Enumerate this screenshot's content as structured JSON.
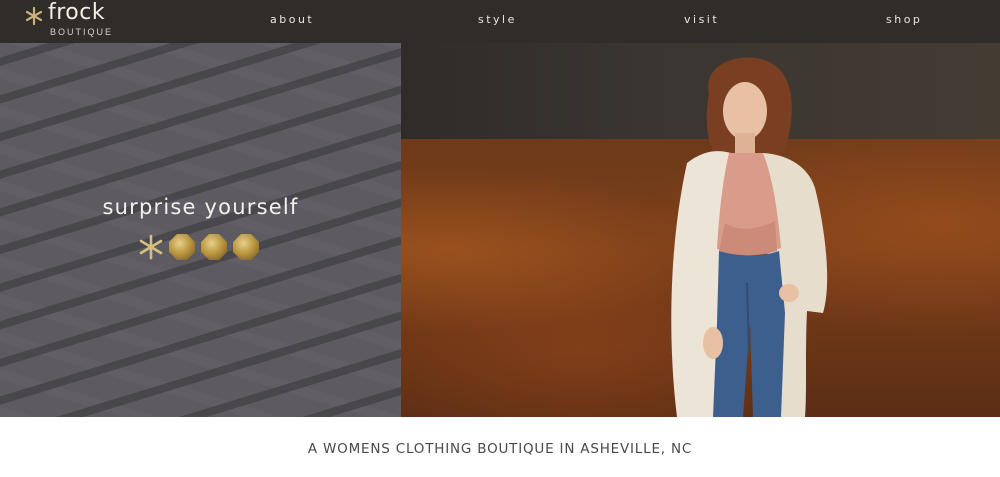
{
  "brand": {
    "name": "frock",
    "sub": "BOUTIQUE",
    "star_icon": "asterisk-star-icon",
    "accent": "#c9b27a"
  },
  "nav": {
    "items": [
      {
        "label": "about"
      },
      {
        "label": "style"
      },
      {
        "label": "visit"
      },
      {
        "label": "shop"
      }
    ],
    "background": "#2f2c29"
  },
  "hero": {
    "tagline": "surprise yourself",
    "decorations": [
      "gold-asterisk-icon",
      "gold-octagon-icon",
      "gold-octagon-icon",
      "gold-octagon-icon"
    ],
    "left_color": "#5d5b60",
    "image": "model-photo"
  },
  "footer": {
    "subtitle": "A WOMENS CLOTHING BOUTIQUE IN ASHEVILLE, NC"
  }
}
